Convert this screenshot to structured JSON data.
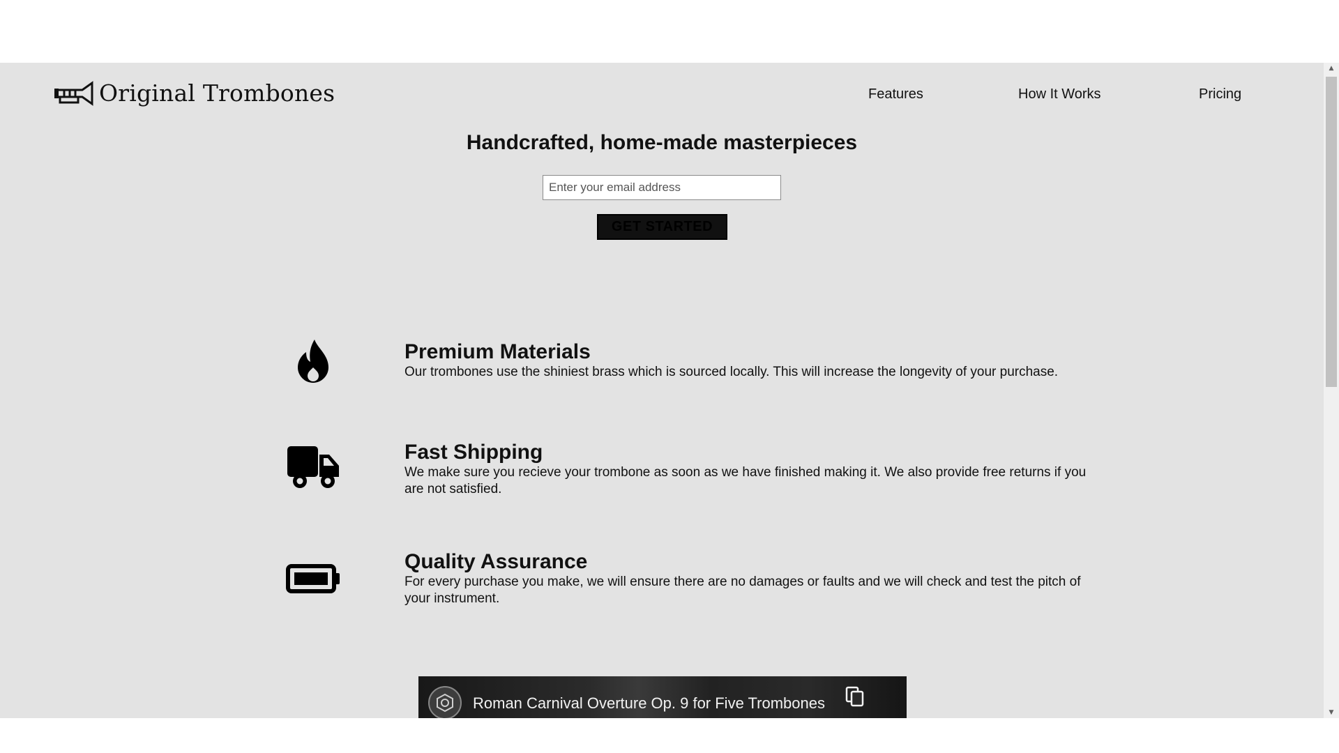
{
  "header": {
    "logo_text": "Original Trombones",
    "nav": [
      {
        "label": "Features"
      },
      {
        "label": "How It Works"
      },
      {
        "label": "Pricing"
      }
    ]
  },
  "hero": {
    "title": "Handcrafted, home-made masterpieces",
    "email_placeholder": "Enter your email address",
    "button_label": "GET STARTED"
  },
  "features": [
    {
      "icon": "fire-icon",
      "title": "Premium Materials",
      "description": "Our trombones use the shiniest brass which is sourced locally. This will increase the longevity of your purchase."
    },
    {
      "icon": "truck-icon",
      "title": "Fast Shipping",
      "description": "We make sure you recieve your trombone as soon as we have finished making it. We also provide free returns if you are not satisfied."
    },
    {
      "icon": "battery-icon",
      "title": "Quality Assurance",
      "description": "For every purchase you make, we will ensure there are no damages or faults and we will check and test the pitch of your instrument."
    }
  ],
  "video": {
    "title": "Roman Carnival Overture Op. 9 for Five Trombones"
  }
}
